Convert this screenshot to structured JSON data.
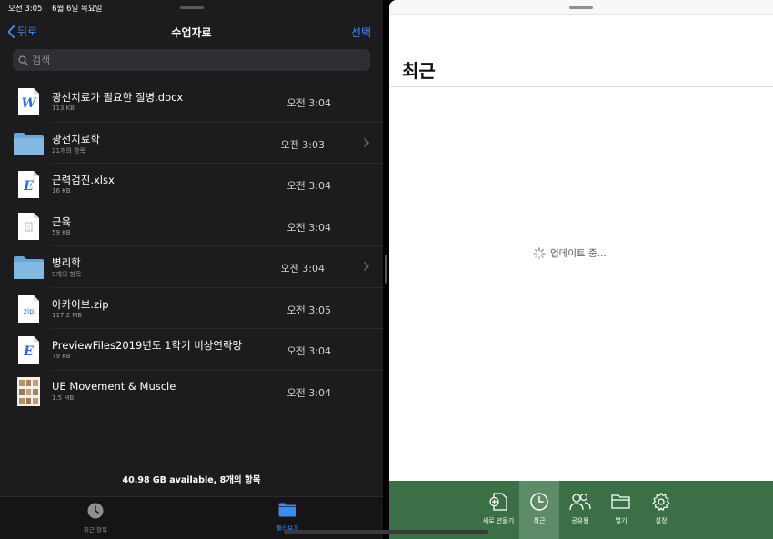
{
  "status_bar": {
    "time": "오전 3:05",
    "date": "6월 6일 목요일"
  },
  "left": {
    "nav": {
      "back_label": "뒤로",
      "title": "수업자료",
      "select_label": "선택"
    },
    "search": {
      "placeholder": "검색"
    },
    "files": [
      {
        "name": "광선치료가 필요한 질병.docx",
        "meta": "113 KB",
        "date": "오전 3:04",
        "icon": "word-doc-icon"
      },
      {
        "name": "광선치료학",
        "meta": "21개의 항목",
        "date": "오전 3:03",
        "icon": "folder-icon"
      },
      {
        "name": "근력검진.xlsx",
        "meta": "16 KB",
        "date": "오전 3:04",
        "icon": "excel-doc-icon"
      },
      {
        "name": "근육",
        "meta": "59 KB",
        "date": "오전 3:04",
        "icon": "document-icon"
      },
      {
        "name": "병리학",
        "meta": "9개의 항목",
        "date": "오전 3:04",
        "icon": "folder-icon"
      },
      {
        "name": "아카이브.zip",
        "meta": "117.2 MB",
        "date": "오전 3:05",
        "icon": "zip-icon"
      },
      {
        "name": "PreviewFiles2019년도 1학기 비상연락망",
        "meta": "79 KB",
        "date": "오전 3:04",
        "icon": "excel-doc-icon"
      },
      {
        "name": "UE Movement & Muscle",
        "meta": "1.5 MB",
        "date": "오전 3:04",
        "icon": "image-thumbnail-icon"
      }
    ],
    "storage": "40.98 GB available, 8개의 항목",
    "tabs": {
      "recent": "최근 항목",
      "browse": "둘러보기"
    }
  },
  "right": {
    "heading": "최근",
    "loading": "업데이트 중...",
    "toolbar": {
      "new": "새로 만들기",
      "recent": "최근",
      "shared": "공유됨",
      "open": "열기",
      "settings": "설정"
    }
  },
  "colors": {
    "accent_blue": "#3b8cf5",
    "word_green": "#3b7046",
    "dark_bg": "#1c1c1e"
  }
}
